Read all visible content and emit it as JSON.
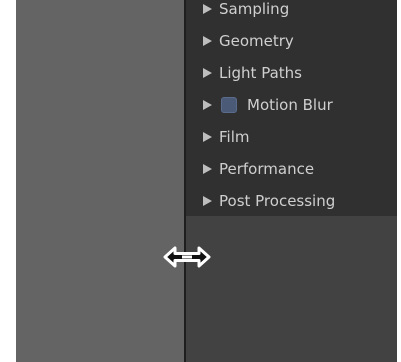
{
  "properties_panel": {
    "sections": [
      {
        "label": "Sampling",
        "has_checkbox": false
      },
      {
        "label": "Geometry",
        "has_checkbox": false
      },
      {
        "label": "Light Paths",
        "has_checkbox": false
      },
      {
        "label": "Motion Blur",
        "has_checkbox": true
      },
      {
        "label": "Film",
        "has_checkbox": false
      },
      {
        "label": "Performance",
        "has_checkbox": false
      },
      {
        "label": "Post Processing",
        "has_checkbox": false
      }
    ]
  },
  "colors": {
    "viewport_gray": "#646464",
    "properties_background": "#424242",
    "panel_background": "#303030",
    "text": "#cfcfcf",
    "checkbox_fill": "#4b5a76"
  },
  "cursor": {
    "icon": "horizontal-resize-cursor-icon"
  }
}
